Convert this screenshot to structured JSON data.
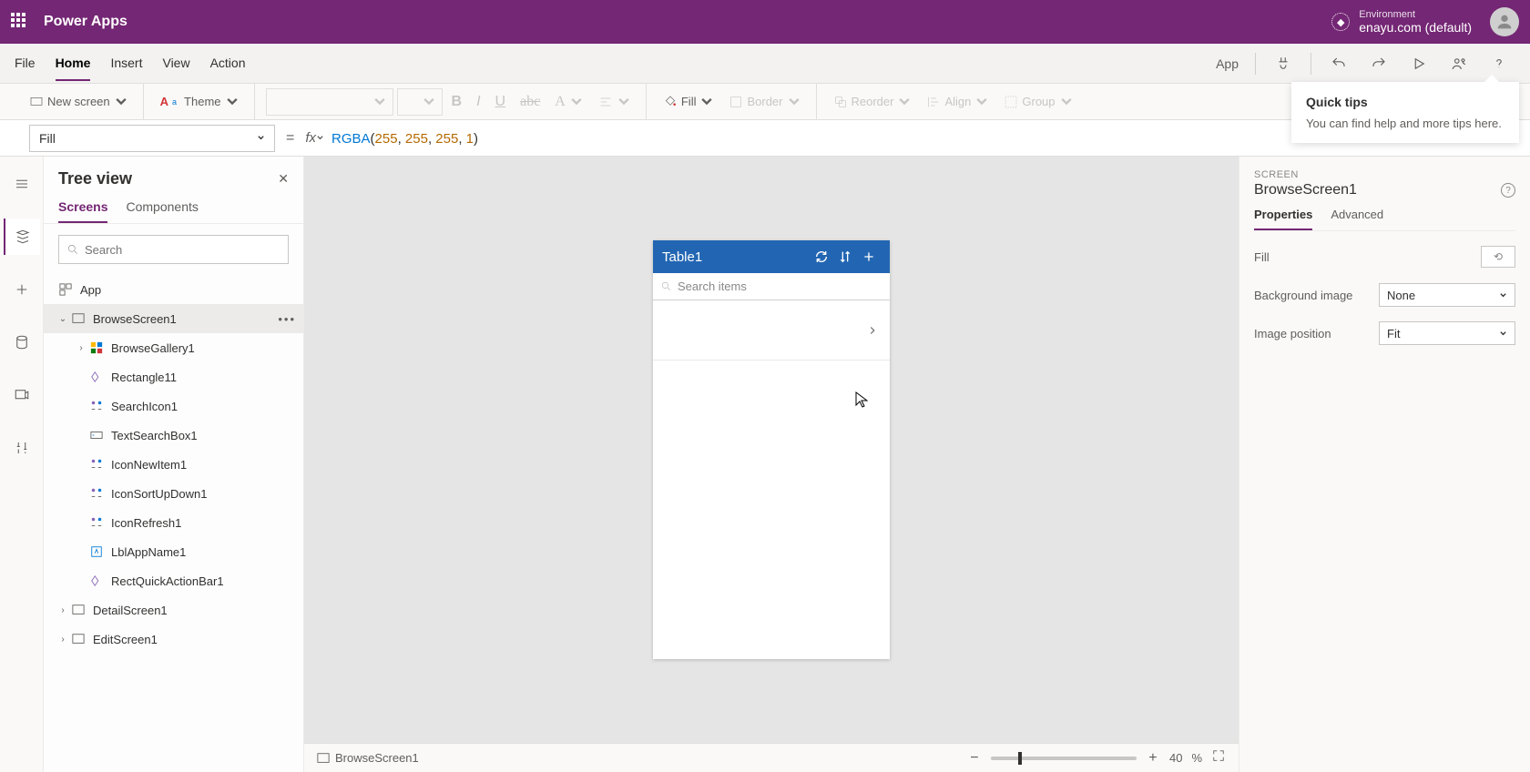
{
  "header": {
    "app_title": "Power Apps",
    "environment_label": "Environment",
    "environment_value": "enayu.com (default)"
  },
  "menu": {
    "items": [
      "File",
      "Home",
      "Insert",
      "View",
      "Action"
    ],
    "active": "Home",
    "app_label": "App"
  },
  "toolbar": {
    "new_screen": "New screen",
    "theme": "Theme",
    "fill": "Fill",
    "border": "Border",
    "reorder": "Reorder",
    "align": "Align",
    "group": "Group"
  },
  "formula": {
    "property": "Fill",
    "fn": "RGBA",
    "args": [
      "255",
      "255",
      "255",
      "1"
    ]
  },
  "quick_tips": {
    "title": "Quick tips",
    "body": "You can find help and more tips here."
  },
  "tree": {
    "title": "Tree view",
    "tabs": [
      "Screens",
      "Components"
    ],
    "active_tab": "Screens",
    "search_placeholder": "Search",
    "nodes": {
      "app": "App",
      "browse_screen": "BrowseScreen1",
      "gallery": "BrowseGallery1",
      "children": [
        "Rectangle11",
        "SearchIcon1",
        "TextSearchBox1",
        "IconNewItem1",
        "IconSortUpDown1",
        "IconRefresh1",
        "LblAppName1",
        "RectQuickActionBar1"
      ],
      "detail_screen": "DetailScreen1",
      "edit_screen": "EditScreen1"
    }
  },
  "canvas": {
    "table_title": "Table1",
    "search_placeholder": "Search items",
    "footer_label": "BrowseScreen1",
    "zoom_value": "40",
    "zoom_unit": "%"
  },
  "props": {
    "kicker": "SCREEN",
    "title": "BrowseScreen1",
    "tabs": [
      "Properties",
      "Advanced"
    ],
    "active_tab": "Properties",
    "fill_label": "Fill",
    "bg_label": "Background image",
    "bg_value": "None",
    "pos_label": "Image position",
    "pos_value": "Fit"
  }
}
